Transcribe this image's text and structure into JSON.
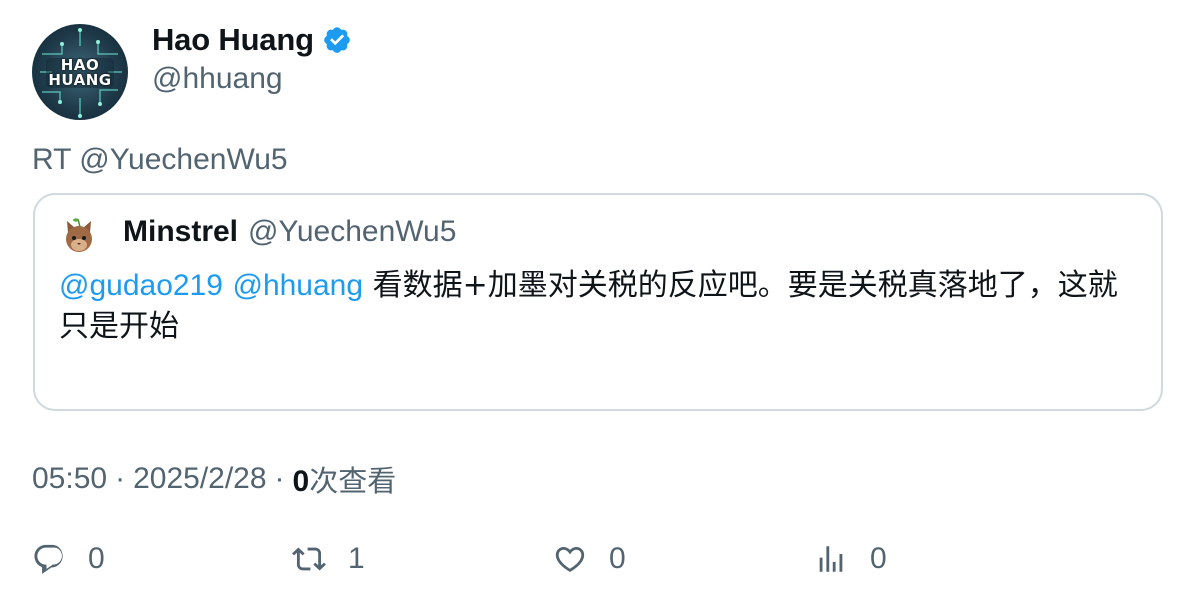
{
  "author": {
    "display_name": "Hao Huang",
    "handle": "@hhuang",
    "avatar_text": "HAO HUANG",
    "verified": true
  },
  "retweet_line": "RT @YuechenWu5",
  "quoted": {
    "display_name": "Minstrel",
    "handle": "@YuechenWu5",
    "mention1": "@gudao219",
    "mention2": "@hhuang",
    "text": "看数据+加墨对关税的反应吧。要是关税真落地了，这就只是开始"
  },
  "meta": {
    "time": "05:50",
    "sep1": "·",
    "date": "2025/2/28",
    "sep2": "·",
    "views_count": "0",
    "views_label": "次查看"
  },
  "actions": {
    "reply_count": "0",
    "repost_count": "1",
    "like_count": "0",
    "views_count": "0"
  },
  "colors": {
    "accent": "#1d9bf0",
    "secondary_text": "#536471",
    "border": "#cfd9de"
  },
  "icons": [
    "verified-badge-icon",
    "reply-icon",
    "repost-icon",
    "like-icon",
    "analytics-icon"
  ]
}
